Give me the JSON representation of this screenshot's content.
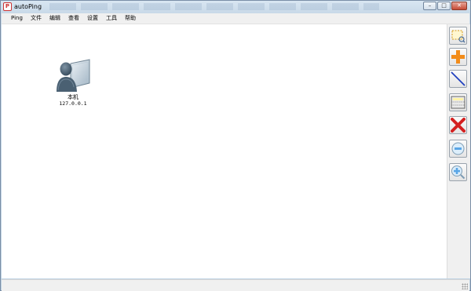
{
  "window": {
    "title": "autoPing",
    "app_icon_text": "P",
    "controls": [
      "minimize",
      "maximize",
      "close"
    ]
  },
  "menu": {
    "items": [
      {
        "label": "Ping"
      },
      {
        "label": "文件"
      },
      {
        "label": "编辑"
      },
      {
        "label": "查看"
      },
      {
        "label": "设置"
      },
      {
        "label": "工具"
      },
      {
        "label": "帮助"
      }
    ]
  },
  "canvas": {
    "nodes": [
      {
        "name": "本机",
        "ip": "127.0.0.1",
        "icon": "computer-user-icon"
      }
    ]
  },
  "toolbar": {
    "tools": [
      {
        "icon": "select-area-icon"
      },
      {
        "icon": "add-node-icon"
      },
      {
        "icon": "draw-line-icon"
      },
      {
        "icon": "grid-layout-icon"
      },
      {
        "icon": "delete-icon"
      },
      {
        "icon": "zoom-out-icon"
      },
      {
        "icon": "zoom-in-icon"
      }
    ]
  },
  "colors": {
    "accent_orange": "#f28c1a",
    "delete_red": "#d42020",
    "line_blue": "#1f3fbf",
    "zoom_blue": "#5aa6e6"
  }
}
